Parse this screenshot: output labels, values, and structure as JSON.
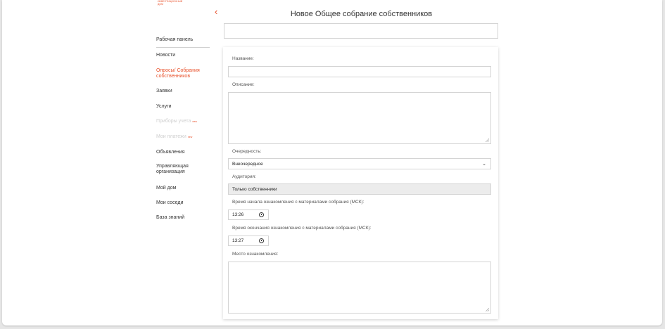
{
  "brand": {
    "logo_text": "ИНВЕСТИЦИОННЫЙ ДОМ"
  },
  "header": {
    "back_icon": "chevron-left-icon",
    "title": "Новое Общее собрание собственников",
    "top_field_value": ""
  },
  "sidebar": {
    "items": [
      {
        "label": "Рабочая панель",
        "state": "normal"
      },
      {
        "label": "Новости",
        "state": "normal"
      },
      {
        "label": "Опросы/ Собрания собственников",
        "state": "active"
      },
      {
        "label": "Заявки",
        "state": "normal"
      },
      {
        "label": "Услуги",
        "state": "normal"
      },
      {
        "label": "Приборы учета",
        "state": "disabled",
        "badge": "new"
      },
      {
        "label": "Мои платежи",
        "state": "disabled",
        "badge": "new"
      },
      {
        "label": "Объявления",
        "state": "normal"
      },
      {
        "label": "Управляющая организация",
        "state": "normal"
      },
      {
        "label": "Мой дом",
        "state": "normal"
      },
      {
        "label": "Мои соседи",
        "state": "normal"
      },
      {
        "label": "База знаний",
        "state": "normal"
      }
    ]
  },
  "form": {
    "name_label": "Название:",
    "name_value": "",
    "description_label": "Описание:",
    "description_value": "",
    "priority_label": "Очередность:",
    "priority_value": "Внеочередное",
    "audience_label": "Аудитория:",
    "audience_value": "Только собственники",
    "start_time_label": "Время начала ознакомления с материалами собрания (МСК):",
    "start_time_value": "13:26",
    "end_time_label": "Время окончания ознакомления с материалами собрания (МСК):",
    "end_time_value": "13:27",
    "place_label": "Место ознакомления:",
    "place_value": ""
  },
  "colors": {
    "accent": "#e8502a",
    "disabled": "#cfcfcf",
    "text": "#333333"
  }
}
